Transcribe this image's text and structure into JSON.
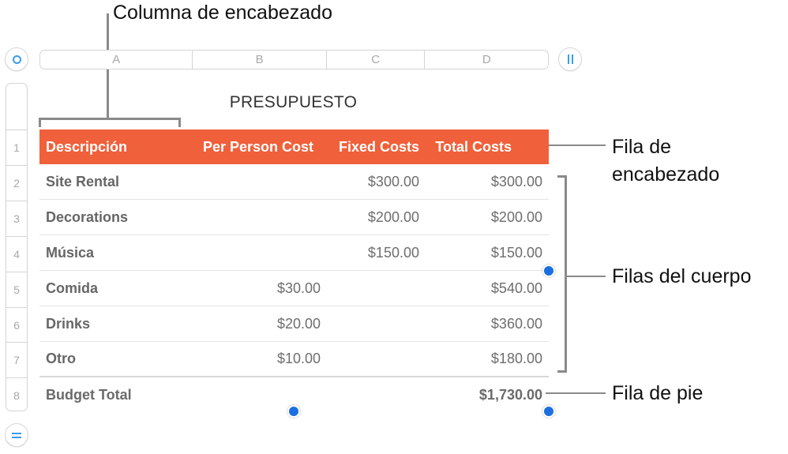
{
  "callouts": {
    "header_column": "Columna de encabezado",
    "header_row_line1": "Fila de",
    "header_row_line2": "encabezado",
    "body_rows": "Filas del cuerpo",
    "footer_row": "Fila de pie"
  },
  "controls": {
    "select_table_icon": "circle-icon",
    "add_column_icon": "pause-bars-icon",
    "add_row_icon": "equals-icon"
  },
  "column_labels": [
    "A",
    "B",
    "C",
    "D"
  ],
  "row_labels": [
    "1",
    "2",
    "3",
    "4",
    "5",
    "6",
    "7",
    "8"
  ],
  "table": {
    "title": "PRESUPUESTO",
    "header": [
      "Descripción",
      "Per Person Cost",
      "Fixed Costs",
      "Total Costs"
    ],
    "rows": [
      [
        "Site Rental",
        "",
        "$300.00",
        "$300.00"
      ],
      [
        "Decorations",
        "",
        "$200.00",
        "$200.00"
      ],
      [
        "Música",
        "",
        "$150.00",
        "$150.00"
      ],
      [
        "Comida",
        "$30.00",
        "",
        "$540.00"
      ],
      [
        "Drinks",
        "$20.00",
        "",
        "$360.00"
      ],
      [
        "Otro",
        "$10.00",
        "",
        "$180.00"
      ]
    ],
    "footer": [
      "Budget Total",
      "",
      "",
      "$1,730.00"
    ]
  },
  "colors": {
    "header_fill": "#f0603a",
    "handle": "#1a6fe0",
    "control_accent": "#3a9bf0"
  }
}
